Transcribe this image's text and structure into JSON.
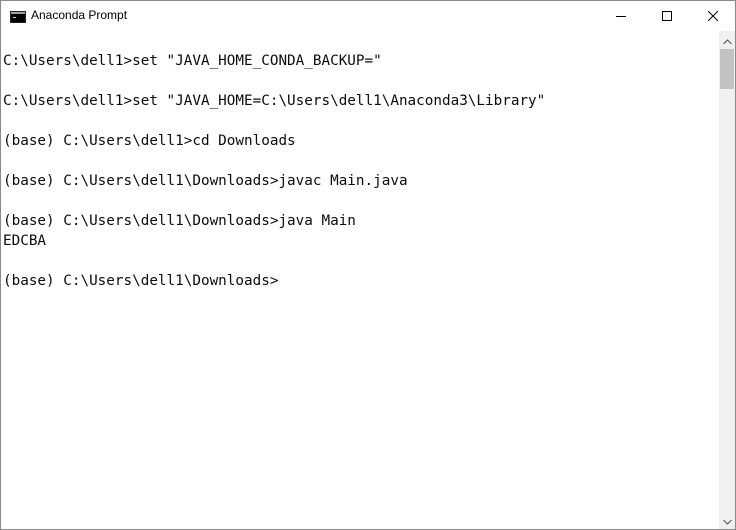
{
  "window": {
    "title": "Anaconda Prompt",
    "icon": "terminal-icon"
  },
  "controls": {
    "minimize_icon": "minimize-icon",
    "maximize_icon": "maximize-icon",
    "close_icon": "close-icon"
  },
  "console": {
    "lines": [
      "C:\\Users\\dell1>set \"JAVA_HOME_CONDA_BACKUP=\"",
      "C:\\Users\\dell1>set \"JAVA_HOME=C:\\Users\\dell1\\Anaconda3\\Library\"",
      "(base) C:\\Users\\dell1>cd Downloads",
      "(base) C:\\Users\\dell1\\Downloads>javac Main.java",
      "(base) C:\\Users\\dell1\\Downloads>java Main",
      "EDCBA",
      "(base) C:\\Users\\dell1\\Downloads>"
    ]
  },
  "colors": {
    "text": "#0c0c0c",
    "background": "#ffffff",
    "scrollbar_track": "#f0f0f0",
    "scrollbar_thumb": "#c2c2c2"
  }
}
